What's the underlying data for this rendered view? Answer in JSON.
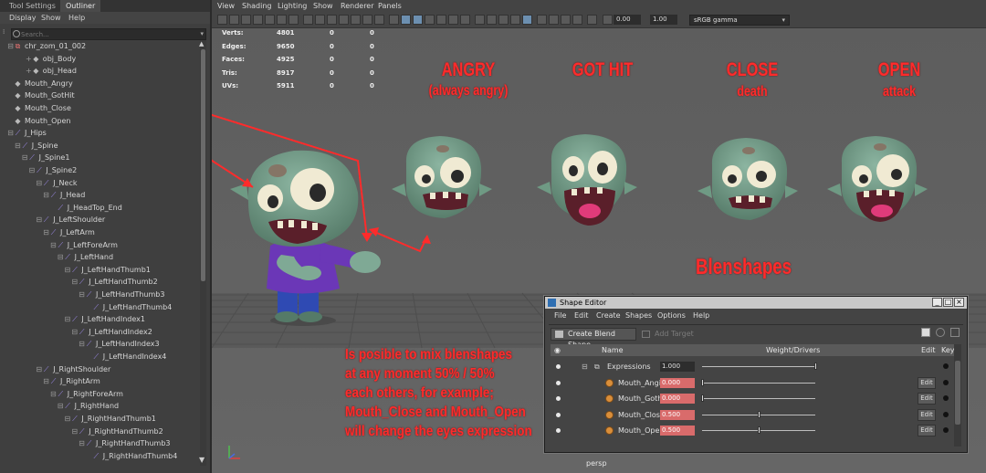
{
  "left_panel": {
    "tabs": [
      "Tool Settings",
      "Outliner"
    ],
    "menu": [
      "Display",
      "Show",
      "Help"
    ],
    "search_placeholder": "Search...",
    "tree": [
      {
        "label": "chr_zom_01_002",
        "depth": 0,
        "icon": "reference-icon",
        "expander": "minus"
      },
      {
        "label": "obj_Body",
        "depth": 1,
        "icon": "mesh-icon",
        "expander": "plus"
      },
      {
        "label": "obj_Head",
        "depth": 1,
        "icon": "mesh-icon",
        "expander": "plus"
      },
      {
        "label": "Mouth_Angry",
        "depth": 0,
        "icon": "mesh-icon",
        "expander": ""
      },
      {
        "label": "Mouth_GotHit",
        "depth": 0,
        "icon": "mesh-icon",
        "expander": ""
      },
      {
        "label": "Mouth_Close",
        "depth": 0,
        "icon": "mesh-icon",
        "expander": ""
      },
      {
        "label": "Mouth_Open",
        "depth": 0,
        "icon": "mesh-icon",
        "expander": ""
      },
      {
        "label": "J_Hips",
        "depth": 0,
        "icon": "joint-icon",
        "expander": "minus"
      },
      {
        "label": "J_Spine",
        "depth": 1,
        "icon": "joint-icon",
        "expander": "minus"
      },
      {
        "label": "J_Spine1",
        "depth": 2,
        "icon": "joint-icon",
        "expander": "minus"
      },
      {
        "label": "J_Spine2",
        "depth": 3,
        "icon": "joint-icon",
        "expander": "minus"
      },
      {
        "label": "J_Neck",
        "depth": 4,
        "icon": "joint-icon",
        "expander": "minus"
      },
      {
        "label": "J_Head",
        "depth": 5,
        "icon": "joint-icon",
        "expander": "minus"
      },
      {
        "label": "J_HeadTop_End",
        "depth": 6,
        "icon": "joint-icon",
        "expander": ""
      },
      {
        "label": "J_LeftShoulder",
        "depth": 4,
        "icon": "joint-icon",
        "expander": "minus"
      },
      {
        "label": "J_LeftArm",
        "depth": 5,
        "icon": "joint-icon",
        "expander": "minus"
      },
      {
        "label": "J_LeftForeArm",
        "depth": 6,
        "icon": "joint-icon",
        "expander": "minus"
      },
      {
        "label": "J_LeftHand",
        "depth": 7,
        "icon": "joint-icon",
        "expander": "minus"
      },
      {
        "label": "J_LeftHandThumb1",
        "depth": 8,
        "icon": "joint-icon",
        "expander": "minus"
      },
      {
        "label": "J_LeftHandThumb2",
        "depth": 9,
        "icon": "joint-icon",
        "expander": "minus"
      },
      {
        "label": "J_LeftHandThumb3",
        "depth": 10,
        "icon": "joint-icon",
        "expander": "minus"
      },
      {
        "label": "J_LeftHandThumb4",
        "depth": 11,
        "icon": "joint-icon",
        "expander": ""
      },
      {
        "label": "J_LeftHandIndex1",
        "depth": 8,
        "icon": "joint-icon",
        "expander": "minus"
      },
      {
        "label": "J_LeftHandIndex2",
        "depth": 9,
        "icon": "joint-icon",
        "expander": "minus"
      },
      {
        "label": "J_LeftHandIndex3",
        "depth": 10,
        "icon": "joint-icon",
        "expander": "minus"
      },
      {
        "label": "J_LeftHandIndex4",
        "depth": 11,
        "icon": "joint-icon",
        "expander": ""
      },
      {
        "label": "J_RightShoulder",
        "depth": 4,
        "icon": "joint-icon",
        "expander": "minus"
      },
      {
        "label": "J_RightArm",
        "depth": 5,
        "icon": "joint-icon",
        "expander": "minus"
      },
      {
        "label": "J_RightForeArm",
        "depth": 6,
        "icon": "joint-icon",
        "expander": "minus"
      },
      {
        "label": "J_RightHand",
        "depth": 7,
        "icon": "joint-icon",
        "expander": "minus"
      },
      {
        "label": "J_RightHandThumb1",
        "depth": 8,
        "icon": "joint-icon",
        "expander": "minus"
      },
      {
        "label": "J_RightHandThumb2",
        "depth": 9,
        "icon": "joint-icon",
        "expander": "minus"
      },
      {
        "label": "J_RightHandThumb3",
        "depth": 10,
        "icon": "joint-icon",
        "expander": "minus"
      },
      {
        "label": "J_RightHandThumb4",
        "depth": 11,
        "icon": "joint-icon",
        "expander": ""
      }
    ]
  },
  "viewport": {
    "menu": [
      "View",
      "Shading",
      "Lighting",
      "Show",
      "Renderer",
      "Panels"
    ],
    "toolbar": {
      "value_1": "0.00",
      "value_2": "1.00",
      "color_space": "sRGB gamma"
    },
    "hud": [
      {
        "label": "Verts:",
        "v1": "4801",
        "v2": "0",
        "v3": "0"
      },
      {
        "label": "Edges:",
        "v1": "9650",
        "v2": "0",
        "v3": "0"
      },
      {
        "label": "Faces:",
        "v1": "4925",
        "v2": "0",
        "v3": "0"
      },
      {
        "label": "Tris:",
        "v1": "8917",
        "v2": "0",
        "v3": "0"
      },
      {
        "label": "UVs:",
        "v1": "5911",
        "v2": "0",
        "v3": "0"
      }
    ],
    "camera_label": "persp",
    "expressions": [
      {
        "title": "ANGRY",
        "subtitle": "(always angry)"
      },
      {
        "title": "GOT HIT",
        "subtitle": ""
      },
      {
        "title": "CLOSE",
        "subtitle": "death"
      },
      {
        "title": "OPEN",
        "subtitle": "attack"
      }
    ],
    "blendshapes_label": "Blenshapes",
    "note_lines": [
      "Is posible to mix blenshapes",
      "at any moment 50% / 50%",
      "each others, for example;",
      "Mouth_Close and Mouth_Open",
      "will change the eyes expression"
    ],
    "annotation_color": "#ff2b2b",
    "skin_color": "#6f9a84"
  },
  "shape_editor": {
    "title": "Shape Editor",
    "window_buttons": [
      "_",
      "□",
      "×"
    ],
    "menu": [
      "File",
      "Edit",
      "Create",
      "Shapes",
      "Options",
      "Help"
    ],
    "create_button": "Create Blend Shape",
    "add_target_button": "Add Target",
    "columns": {
      "name": "Name",
      "weight": "Weight/Drivers",
      "edit": "Edit",
      "key": "Key"
    },
    "rows": [
      {
        "name": "Expressions",
        "value": "1.000",
        "weight": 1.0,
        "edit": ""
      },
      {
        "name": "Mouth_Angi",
        "value": "0.000",
        "weight": 0.0,
        "edit": "Edit"
      },
      {
        "name": "Mouth_Goth",
        "value": "0.000",
        "weight": 0.0,
        "edit": "Edit"
      },
      {
        "name": "Mouth_Clos",
        "value": "0.500",
        "weight": 0.5,
        "edit": "Edit"
      },
      {
        "name": "Mouth_Ope",
        "value": "0.500",
        "weight": 0.5,
        "edit": "Edit"
      }
    ]
  }
}
